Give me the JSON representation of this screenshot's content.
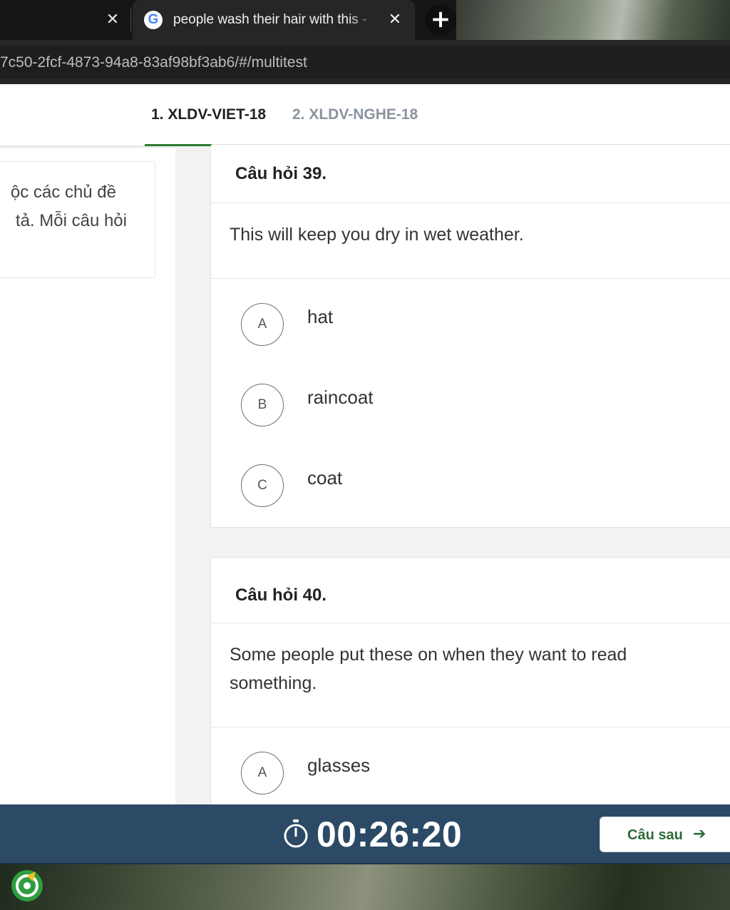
{
  "browser": {
    "prev_tab_close": "✕",
    "active_tab": {
      "favicon": "google-g-icon",
      "favicon_letter": "G",
      "title": "people wash their hair with this -",
      "close": "✕"
    },
    "new_tab": "+",
    "url": "7c50-2fcf-4873-94a8-83af98bf3ab6/#/multitest"
  },
  "nav": {
    "tabs": [
      {
        "label": "1. XLDV-VIET-18",
        "active": true
      },
      {
        "label": "2. XLDV-NGHE-18",
        "active": false
      }
    ]
  },
  "intro": {
    "lines": [
      "ộc các chủ đề",
      "tả. Mỗi câu hỏi"
    ]
  },
  "questions": [
    {
      "title": "Câu hỏi 39.",
      "prompt": "This will keep you dry in wet weather.",
      "options": [
        {
          "letter": "A",
          "text": "hat"
        },
        {
          "letter": "B",
          "text": "raincoat"
        },
        {
          "letter": "C",
          "text": "coat"
        }
      ]
    },
    {
      "title": "Câu hỏi 40.",
      "prompt": "Some people put these on when they want to read something.",
      "options": [
        {
          "letter": "A",
          "text": "glasses"
        }
      ]
    }
  ],
  "footer": {
    "timer_icon": "stopwatch-icon",
    "timer": "00:26:20",
    "next_label": "Câu sau",
    "next_icon": "arrow-right-icon"
  },
  "colors": {
    "accent_green": "#2e7d32",
    "footer_bg": "#2c4a66",
    "inactive_tab": "#8a94a0"
  }
}
